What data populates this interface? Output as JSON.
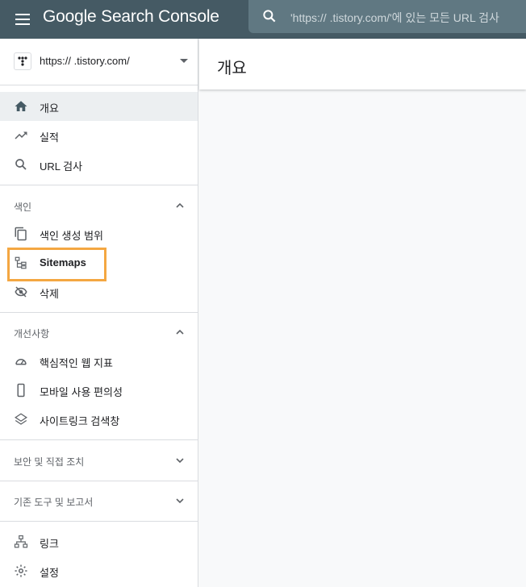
{
  "app": {
    "title": "Google Search Console",
    "search_placeholder": "'https://          .tistory.com/'에 있는 모든 URL 검사"
  },
  "property": {
    "url": "https://          .tistory.com/"
  },
  "nav": {
    "main": [
      {
        "label": "개요",
        "icon": "home-icon",
        "active": true
      },
      {
        "label": "실적",
        "icon": "trending-up-icon"
      },
      {
        "label": "URL 검사",
        "icon": "search-icon"
      }
    ],
    "index_section": {
      "label": "색인",
      "items": [
        {
          "label": "색인 생성 범위",
          "icon": "copy-icon"
        },
        {
          "label": "Sitemaps",
          "icon": "sitemap-icon",
          "highlighted": true
        },
        {
          "label": "삭제",
          "icon": "visibility-off-icon"
        }
      ]
    },
    "enhancements_section": {
      "label": "개선사항",
      "items": [
        {
          "label": "핵심적인 웹 지표",
          "icon": "speed-icon"
        },
        {
          "label": "모바일 사용 편의성",
          "icon": "smartphone-icon"
        },
        {
          "label": "사이트링크 검색창",
          "icon": "layers-icon"
        }
      ]
    },
    "security_section": {
      "label": "보안 및 직접 조치"
    },
    "legacy_section": {
      "label": "기존 도구 및 보고서"
    },
    "bottom": [
      {
        "label": "링크",
        "icon": "links-icon"
      },
      {
        "label": "설정",
        "icon": "settings-icon"
      }
    ]
  },
  "main": {
    "title": "개요"
  },
  "colors": {
    "topbar": "#455a64",
    "highlight": "#f4a742",
    "active_bg": "#eceff1"
  }
}
